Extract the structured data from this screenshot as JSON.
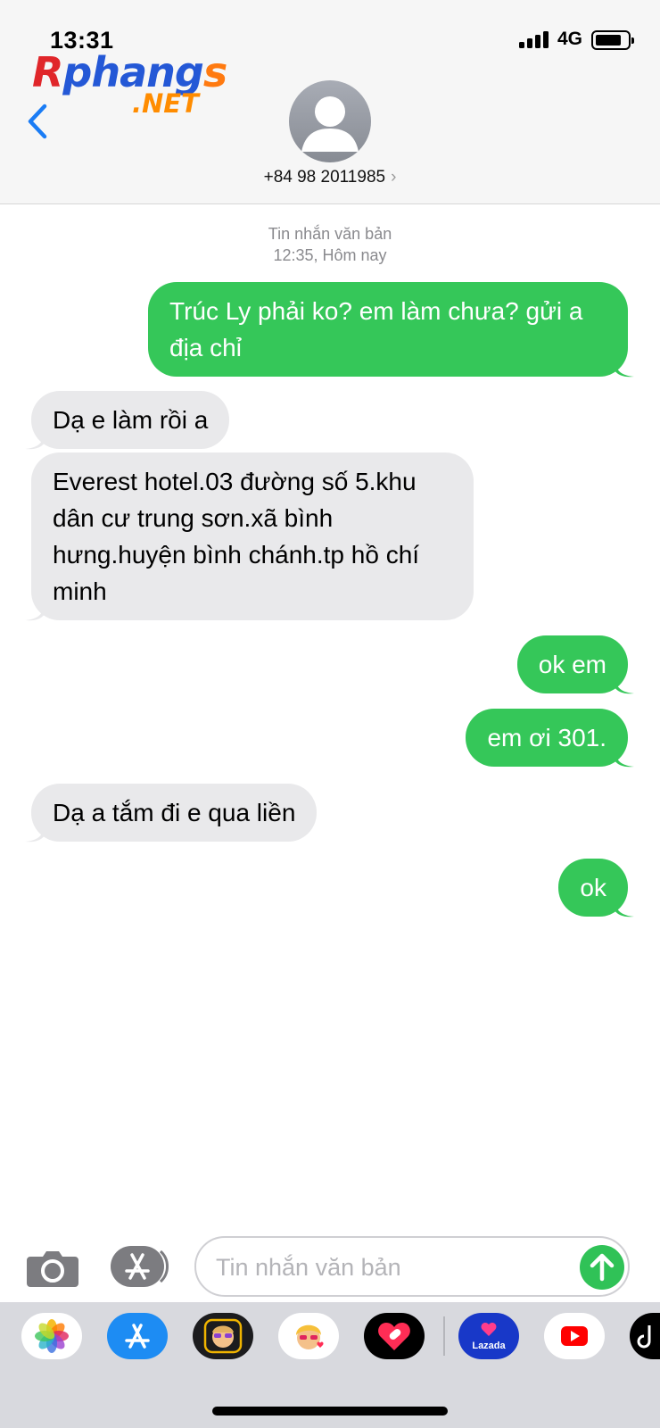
{
  "status_bar": {
    "time": "13:31",
    "network": "4G"
  },
  "watermark": {
    "first_letter": "R",
    "middle": "phang",
    "last_letter": "s",
    "suffix": ".NET"
  },
  "header": {
    "contact": "+84 98 2011985",
    "chevron": "›"
  },
  "conversation": {
    "timestamp_line1": "Tin nhắn văn bản",
    "timestamp_line2": "12:35, Hôm nay",
    "messages": [
      {
        "from": "me",
        "text": "Trúc Ly phải ko? em làm chưa? gửi a địa chỉ"
      },
      {
        "from": "them",
        "text": "Dạ e làm rồi a"
      },
      {
        "from": "them",
        "text": "Everest hotel.03 đường số 5.khu dân cư trung sơn.xã bình hưng.huyện bình chánh.tp hồ chí minh"
      },
      {
        "from": "me",
        "text": "ok em"
      },
      {
        "from": "me",
        "text": "em ơi 301."
      },
      {
        "from": "them",
        "text": "Dạ a tắm đi e qua liền"
      },
      {
        "from": "me",
        "text": "ok"
      }
    ]
  },
  "composer": {
    "placeholder": "Tin nhắn văn bản",
    "value": ""
  },
  "app_drawer": {
    "apps": [
      "photos-app-icon",
      "app-store-app-icon",
      "memoji-app-icon",
      "memoji-stickers-app-icon",
      "heart-sticker-app-icon",
      "lazada-app-icon",
      "youtube-app-icon",
      "tiktok-app-icon"
    ],
    "lazada_label": "Lazada"
  },
  "colors": {
    "sent_bubble": "#35c759",
    "received_bubble": "#e9e9eb",
    "accent": "#1a7cf5",
    "timestamp": "#8a8a8e"
  }
}
